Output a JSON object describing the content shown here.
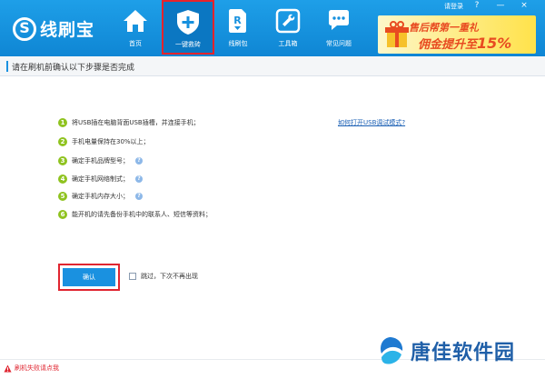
{
  "app": {
    "name": "线刷宝",
    "login_label": "请登录",
    "help_icon": "?",
    "minimize_icon": "—",
    "close_icon": "×"
  },
  "nav": {
    "items": [
      {
        "label": "首页",
        "icon": "home-icon"
      },
      {
        "label": "一键救砖",
        "icon": "shield-plus-icon",
        "active": true
      },
      {
        "label": "线刷包",
        "icon": "rom-package-icon"
      },
      {
        "label": "工具箱",
        "icon": "wrench-icon"
      },
      {
        "label": "常见问题",
        "icon": "chat-icon"
      }
    ]
  },
  "banner": {
    "line1": "售后帮第一重礼",
    "line2_prefix": "佣金提升至",
    "line2_value": "15%"
  },
  "header": {
    "title": "请在刷机前确认以下步骤是否完成"
  },
  "steps": [
    {
      "num": "1",
      "text": "将USB插在电脑背面USB插槽，并连接手机；"
    },
    {
      "num": "2",
      "text": "手机电量保持在30%以上；"
    },
    {
      "num": "3",
      "text": "确定手机品牌型号；"
    },
    {
      "num": "4",
      "text": "确定手机网络制式；"
    },
    {
      "num": "5",
      "text": "确定手机内存大小；"
    },
    {
      "num": "6",
      "text": "能开机的请先备份手机中的联系人、短信等资料；"
    }
  ],
  "help_mark": "?",
  "debug_link": "如何打开USB调试模式?",
  "confirm_label": "确认",
  "skip_label": "跳过，下次不再出现",
  "footer": {
    "fail_help": "刷机失败请点我"
  },
  "watermark": {
    "text": "唐佳软件园"
  },
  "colors": {
    "topbar": "#1e9fe8",
    "accent": "#1a91e0",
    "step_badge": "#8fc31f",
    "highlight_border": "#e02530",
    "link": "#1a5fb4"
  }
}
